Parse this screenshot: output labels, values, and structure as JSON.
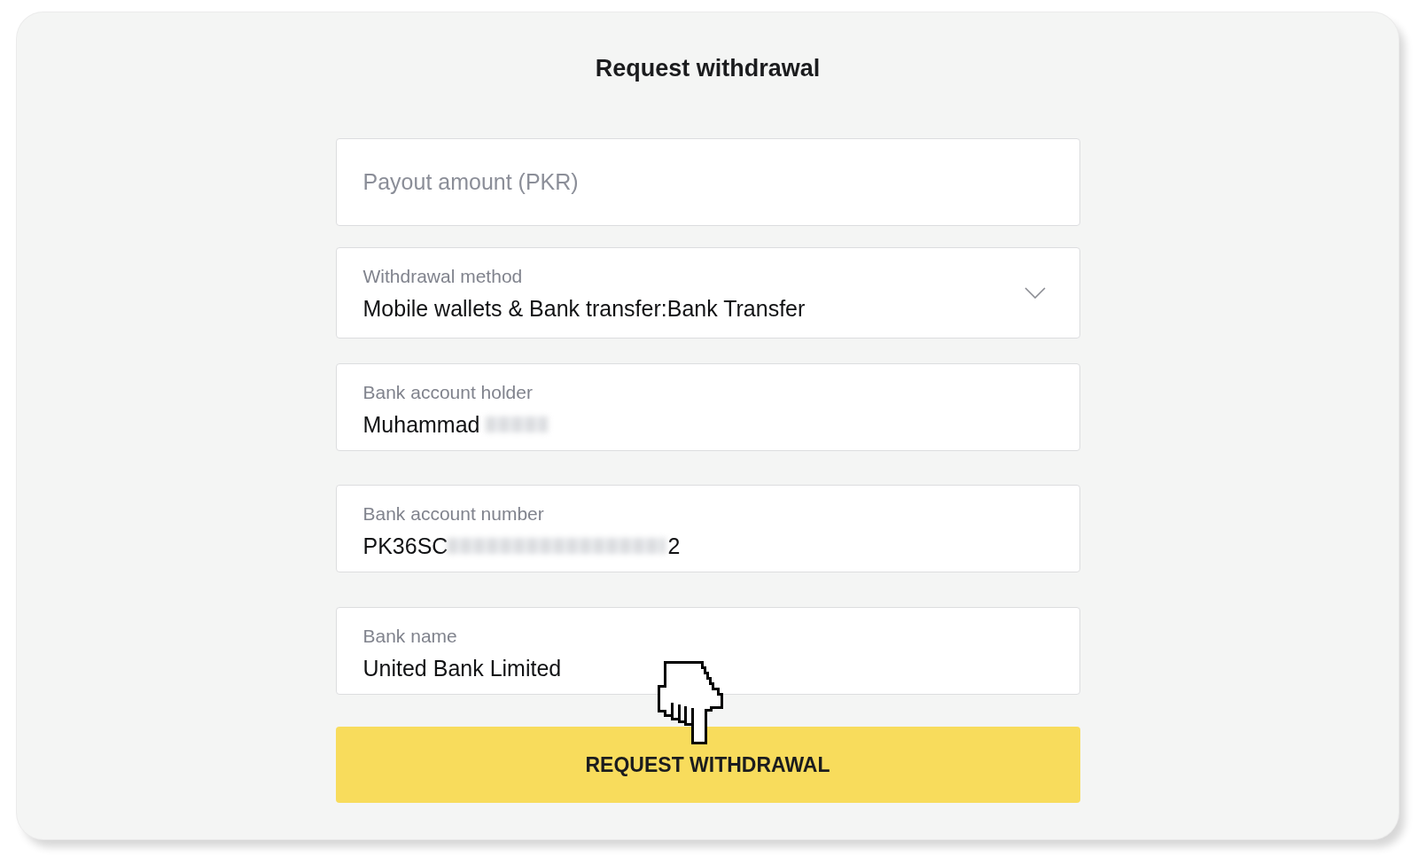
{
  "title": "Request withdrawal",
  "fields": [
    {
      "kind": "input",
      "placeholder": "Payout amount (PKR)"
    },
    {
      "kind": "select",
      "label": "Withdrawal method",
      "value": "Mobile wallets & Bank transfer:Bank Transfer",
      "redacted": false
    },
    {
      "kind": "input",
      "label": "Bank account holder",
      "value": "Muhammad",
      "redacted": true
    },
    {
      "kind": "input",
      "label": "Bank account number",
      "value": "PK36SC",
      "value_end": "2",
      "redacted": true
    },
    {
      "kind": "input",
      "label": "Bank name",
      "value": "United Bank Limited",
      "redacted": false
    }
  ],
  "submit_button": "REQUEST WITHDRAWAL"
}
